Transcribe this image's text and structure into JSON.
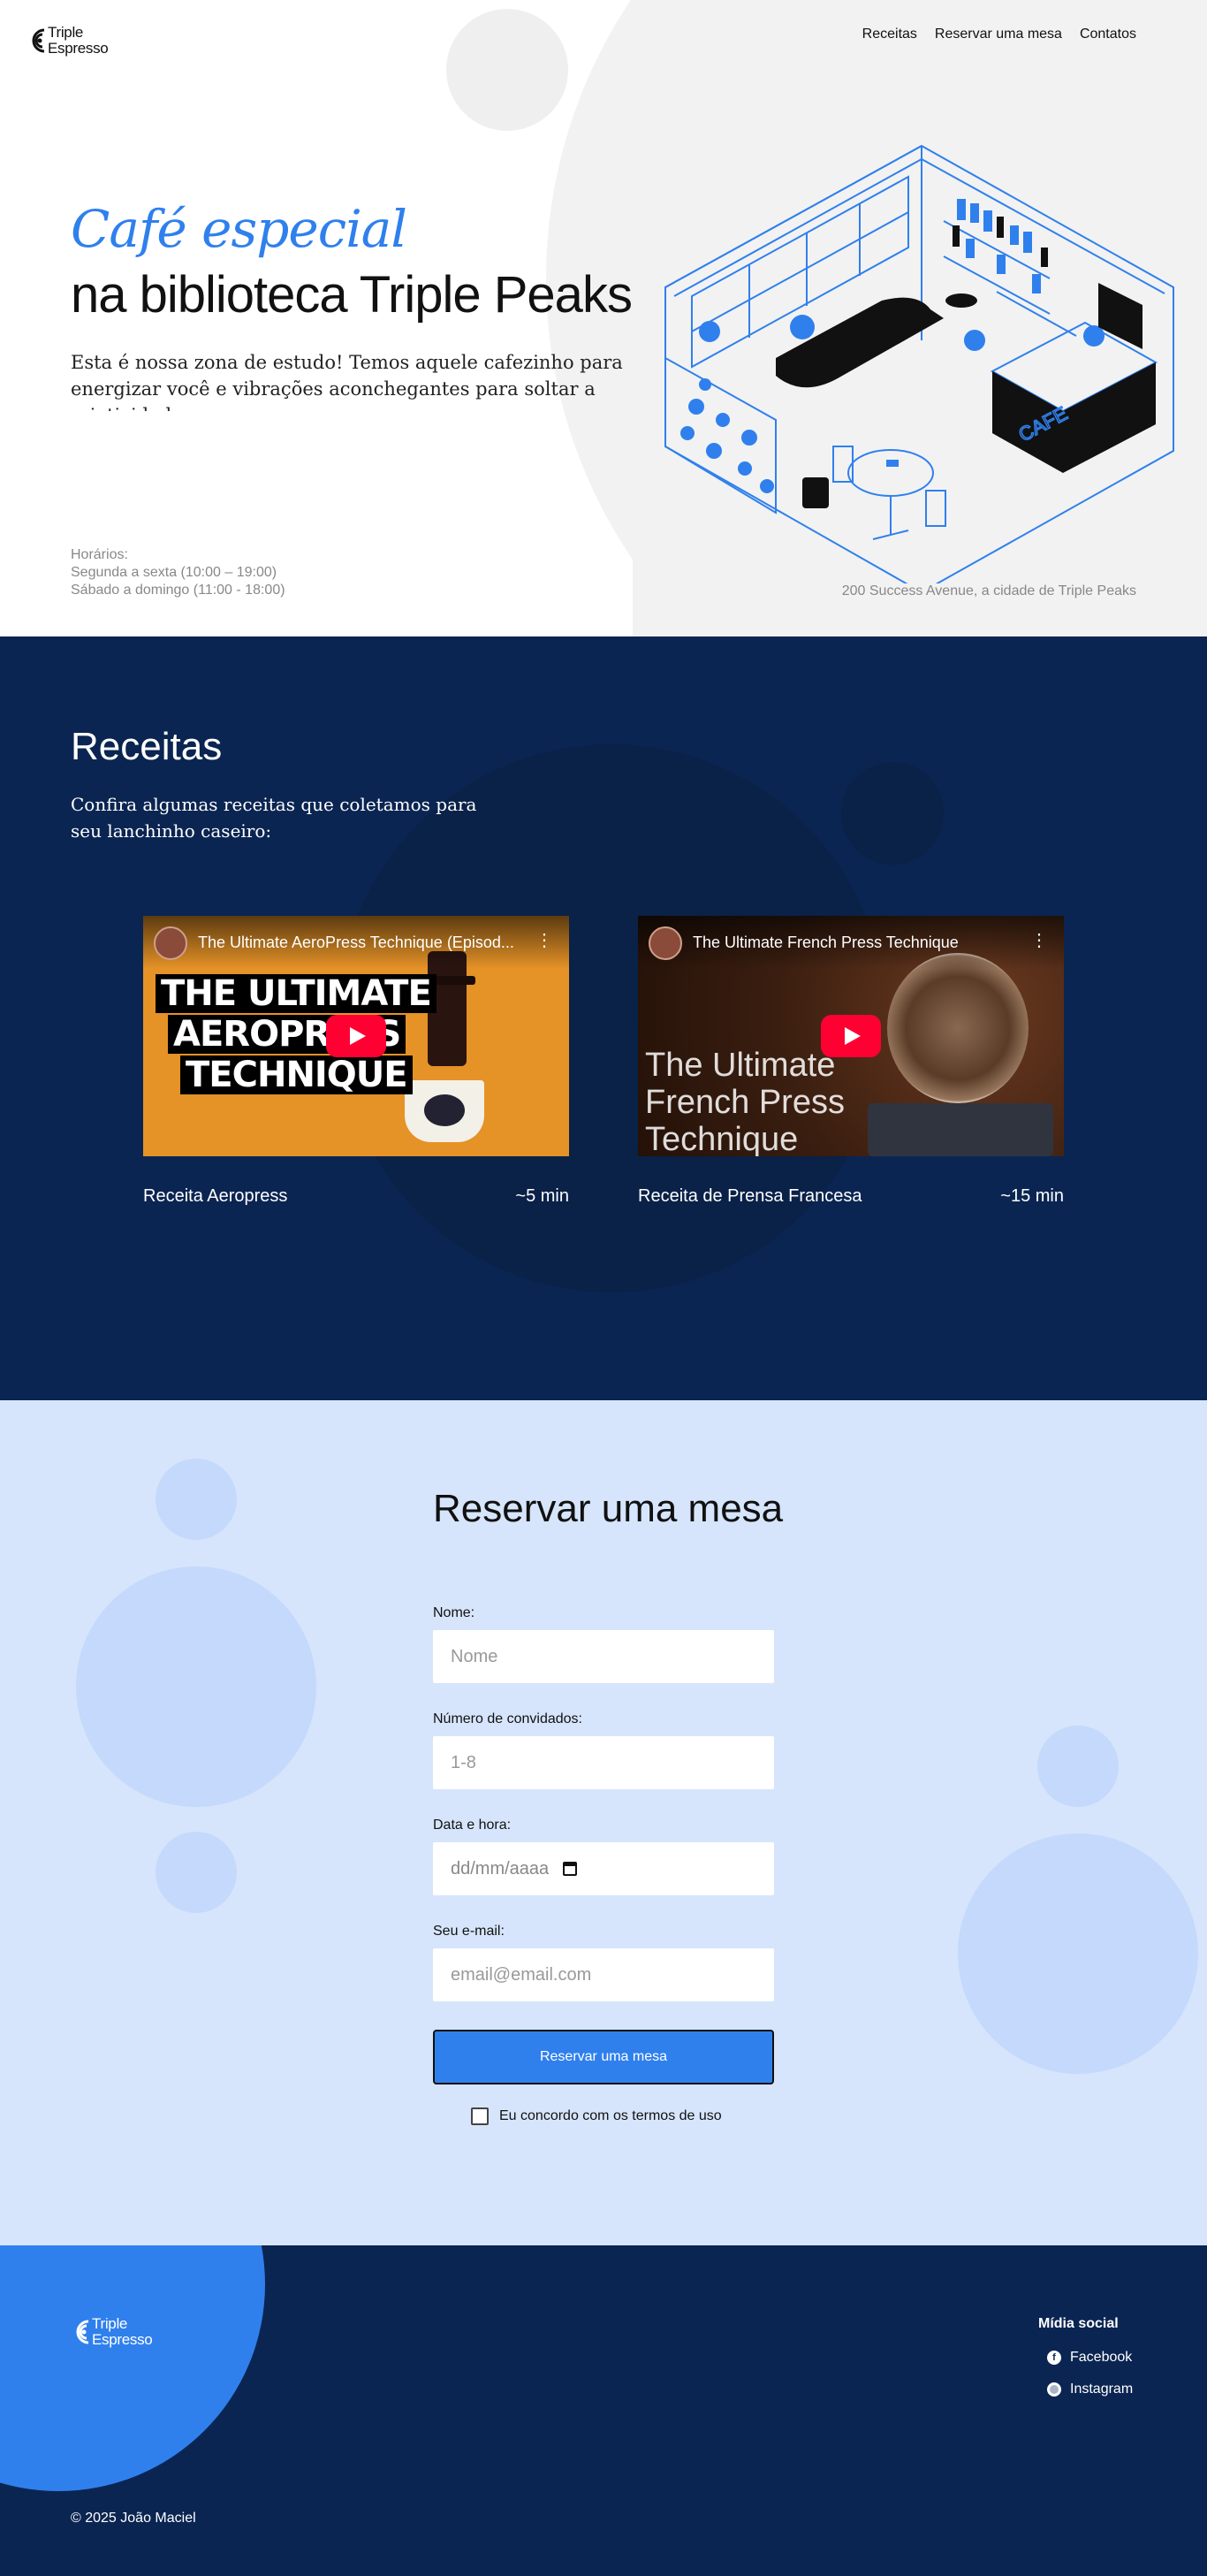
{
  "brand": {
    "name_line1": "Triple",
    "name_line2": "Espresso"
  },
  "nav": {
    "items": [
      "Receitas",
      "Reservar uma mesa",
      "Contatos"
    ]
  },
  "hero": {
    "title_accent": "Café especial",
    "title_rest": "na biblioteca Triple Peaks",
    "description": "Esta é nossa zona de estudo! Temos aquele cafezinho para energizar você e vibrações aconchegantes para soltar a criatividade.",
    "hours_label": "Horários:",
    "hours_weekdays": "Segunda a sexta (10:00 – 19:00)",
    "hours_weekend": "Sábado a domingo (11:00 - 18:00)",
    "address": "200 Success Avenue, a cidade de Triple Peaks",
    "illustration_sign": "CAFE"
  },
  "recipes": {
    "title": "Receitas",
    "description": "Confira algumas receitas que coletamos para seu lanchinho caseiro:",
    "videos": [
      {
        "video_title": "The Ultimate AeroPress Technique (Episod...",
        "thumb_text": [
          "THE ULTIMATE",
          "AEROPRESS",
          "TECHNIQUE"
        ],
        "label": "Receita Aeropress",
        "duration": "~5 min"
      },
      {
        "video_title": "The Ultimate French Press Technique",
        "thumb_text": "The Ultimate French Press Technique",
        "label": "Receita de Prensa Francesa",
        "duration": "~15 min"
      }
    ]
  },
  "reservation": {
    "title": "Reservar uma mesa",
    "name_label": "Nome:",
    "name_placeholder": "Nome",
    "guests_label": "Número de convidados:",
    "guests_placeholder": "1-8",
    "date_label": "Data e hora:",
    "date_placeholder": "dd/mm/aaaa",
    "email_label": "Seu e-mail:",
    "email_placeholder": "email@email.com",
    "submit_label": "Reservar uma mesa",
    "terms_label": "Eu concordo com os termos de uso"
  },
  "footer": {
    "social_title": "Mídia social",
    "facebook": "Facebook",
    "instagram": "Instagram",
    "copyright": "© 2025 João Maciel"
  },
  "colors": {
    "accent": "#2f80ed",
    "navy": "#0b2552",
    "light_blue": "#d6e5fc"
  }
}
